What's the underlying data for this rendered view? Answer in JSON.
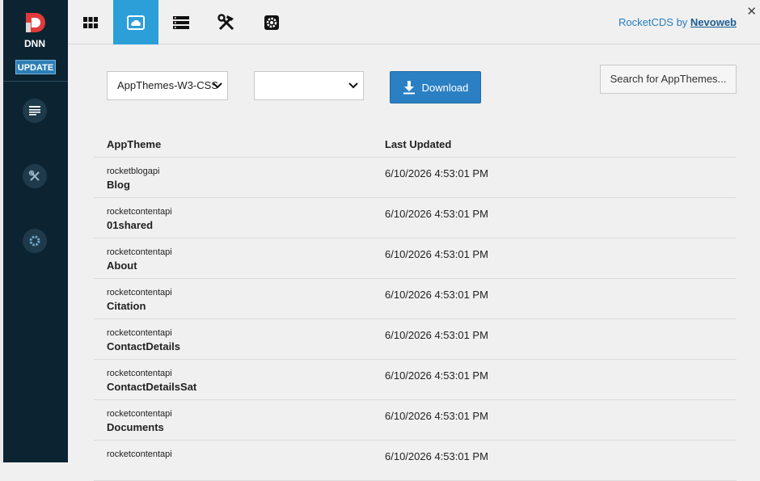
{
  "sidebar": {
    "update_label": "UPDATE",
    "items": [
      {
        "name": "content-icon"
      },
      {
        "name": "tools-icon"
      },
      {
        "name": "settings-icon"
      }
    ]
  },
  "topbar": {
    "tabs": [
      {
        "name": "dashboard-grid-icon",
        "active": false
      },
      {
        "name": "cloud-icon",
        "active": true
      },
      {
        "name": "list-icon",
        "active": false
      },
      {
        "name": "tools-icon",
        "active": false
      },
      {
        "name": "settings-icon",
        "active": false
      }
    ],
    "brand_prefix": "RocketCDS by ",
    "brand_link": "Nevoweb",
    "close_label": "✕"
  },
  "filters": {
    "apptheme_select": "AppThemes-W3-CSS",
    "second_select": ""
  },
  "download_label": "Download",
  "search_label": "Search for AppThemes...",
  "table": {
    "headers": [
      "AppTheme",
      "Last Updated"
    ],
    "rows": [
      {
        "system": "rocketblogapi",
        "name": "Blog",
        "updated": "6/10/2026 4:53:01 PM"
      },
      {
        "system": "rocketcontentapi",
        "name": "01shared",
        "updated": "6/10/2026 4:53:01 PM"
      },
      {
        "system": "rocketcontentapi",
        "name": "About",
        "updated": "6/10/2026 4:53:01 PM"
      },
      {
        "system": "rocketcontentapi",
        "name": "Citation",
        "updated": "6/10/2026 4:53:01 PM"
      },
      {
        "system": "rocketcontentapi",
        "name": "ContactDetails",
        "updated": "6/10/2026 4:53:01 PM"
      },
      {
        "system": "rocketcontentapi",
        "name": "ContactDetailsSat",
        "updated": "6/10/2026 4:53:01 PM"
      },
      {
        "system": "rocketcontentapi",
        "name": "Documents",
        "updated": "6/10/2026 4:53:01 PM"
      },
      {
        "system": "rocketcontentapi",
        "name": "",
        "updated": "6/10/2026 4:53:01 PM"
      }
    ]
  },
  "colors": {
    "sidebar_bg": "#0c2432",
    "accent": "#2c9fd8",
    "button": "#2b80c4"
  }
}
